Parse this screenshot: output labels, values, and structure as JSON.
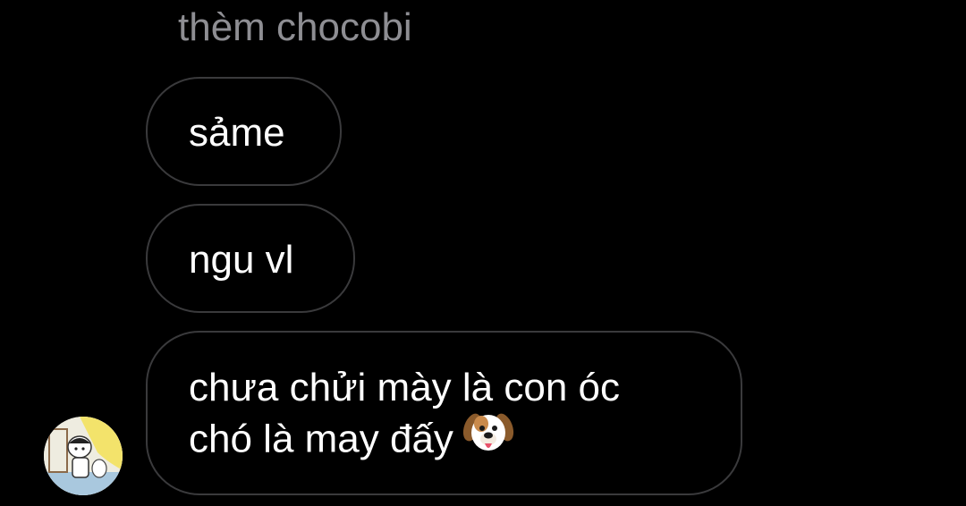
{
  "conversation": {
    "previous_message": "thèm chocobi",
    "messages": [
      {
        "text": "sảme"
      },
      {
        "text": "ngu vl"
      },
      {
        "lines": [
          "chưa chửi mày là con óc",
          "chó là may đấy"
        ],
        "emoji": "dog-face-icon"
      }
    ]
  },
  "colors": {
    "background": "#000000",
    "bubble_border": "#3a3a3c",
    "text": "#ffffff",
    "muted_text": "#8e8e93"
  }
}
